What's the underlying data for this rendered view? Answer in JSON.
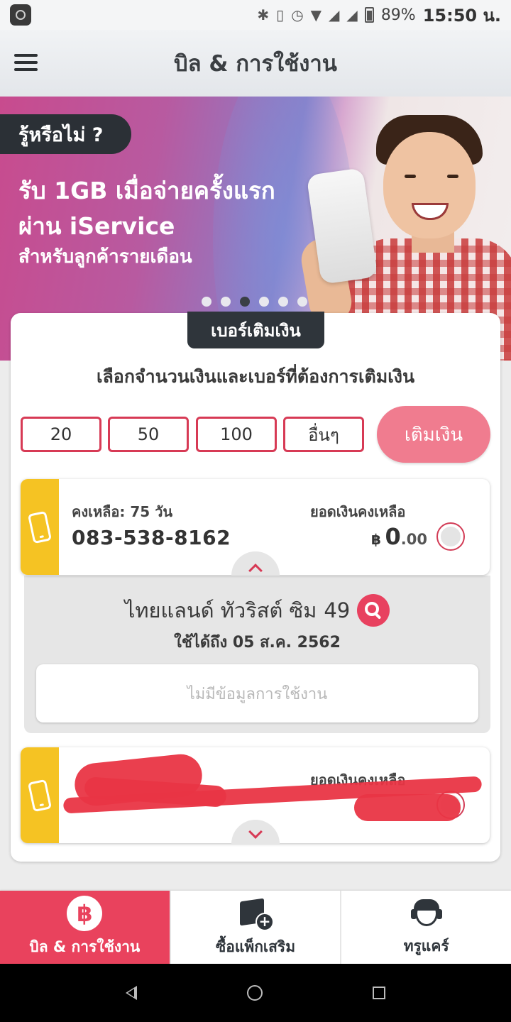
{
  "status_bar": {
    "battery": "89%",
    "time": "15:50 น.",
    "icons": [
      "bluetooth-icon",
      "vibrate-icon",
      "alarm-icon",
      "wifi-icon",
      "signal-icon",
      "signal-icon",
      "battery-icon"
    ]
  },
  "header": {
    "title": "บิล & การใช้งาน",
    "menu_icon": "hamburger-menu-icon"
  },
  "banner": {
    "tag": "รู้หรือไม่ ?",
    "line1": "รับ 1GB เมื่อจ่ายครั้งแรก",
    "line2": "ผ่าน iService",
    "line3": "สำหรับลูกค้ารายเดือน",
    "slide_count": 6,
    "active_slide": 3
  },
  "topup": {
    "tab_label": "เบอร์เติมเงิน",
    "subtitle": "เลือกจำนวนเงินและเบอร์ที่ต้องการเติมเงิน",
    "amounts": [
      "20",
      "50",
      "100",
      "อื่นๆ"
    ],
    "topup_button": "เติมเงิน",
    "accent": "#d73a55",
    "button_color": "#f07c8f"
  },
  "numbers": [
    {
      "days_left": "คงเหลือ: 75 วัน",
      "phone": "083-538-8162",
      "balance_label": "ยอดเงินคงเหลือ",
      "currency": "฿",
      "balance_int": "0",
      "balance_dec": ".00",
      "expanded": true
    },
    {
      "days_left": "",
      "phone": "",
      "balance_label": "ยอดเงินคงเหลือ",
      "expanded": false
    }
  ],
  "package": {
    "name": "ไทยแลนด์ ทัวริสต์ ซิม",
    "price": "49",
    "expiry": "ใช้ได้ถึง 05 ส.ค. 2562",
    "no_usage": "ไม่มีข้อมูลการใช้งาน"
  },
  "bottom_nav": {
    "items": [
      {
        "label": "บิล & การใช้งาน",
        "icon": "baht-icon",
        "active": true
      },
      {
        "label": "ซื้อแพ็กเสริม",
        "icon": "package-add-icon",
        "active": false
      },
      {
        "label": "ทรูแคร์",
        "icon": "customer-care-icon",
        "active": false
      }
    ],
    "active_color": "#e9425d"
  }
}
